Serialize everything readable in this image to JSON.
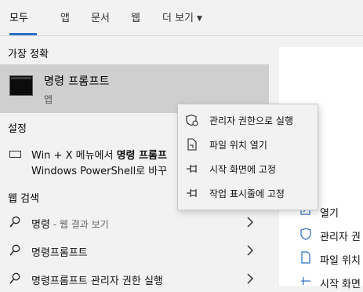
{
  "tabs": [
    {
      "label": "모두",
      "active": true
    },
    {
      "label": "앱"
    },
    {
      "label": "문서"
    },
    {
      "label": "웹"
    },
    {
      "label": "더 보기"
    }
  ],
  "best_match": {
    "heading": "가장 정확",
    "title": "명령 프롬프트",
    "subtitle": "앱",
    "icon": "cmd-icon"
  },
  "settings": {
    "heading": "설정",
    "line1_prefix": "Win + X 메뉴에서 ",
    "line1_bold": "명령 프롬프",
    "line2": "Windows PowerShell로 바꾸"
  },
  "web_search": {
    "heading": "웹 검색",
    "rows": [
      {
        "query": "명령",
        "suffix": " - 웹 결과 보기"
      },
      {
        "query": "명령프롬프트",
        "suffix": ""
      },
      {
        "query": "명령프롬프트 관리자 권한 실행",
        "suffix": ""
      }
    ]
  },
  "context_menu": {
    "items": [
      {
        "label": "관리자 권한으로 실행",
        "icon": "shield-icon"
      },
      {
        "label": "파일 위치 열기",
        "icon": "file-location-icon"
      },
      {
        "label": "시작 화면에 고정",
        "icon": "pin-icon"
      },
      {
        "label": "작업 표시줄에 고정",
        "icon": "pin-icon"
      }
    ]
  },
  "right_pane": {
    "items": [
      {
        "label": "열기",
        "icon": "open-icon"
      },
      {
        "label": "관리자 권",
        "icon": "shield-icon"
      },
      {
        "label": "파일 위치",
        "icon": "file-location-icon"
      },
      {
        "label": "시작 화면",
        "icon": "pin-icon"
      }
    ]
  },
  "colors": {
    "accent": "#2b6fc4",
    "selected_bg": "#cfcfcf",
    "menu_bg": "#f2f2f2"
  }
}
